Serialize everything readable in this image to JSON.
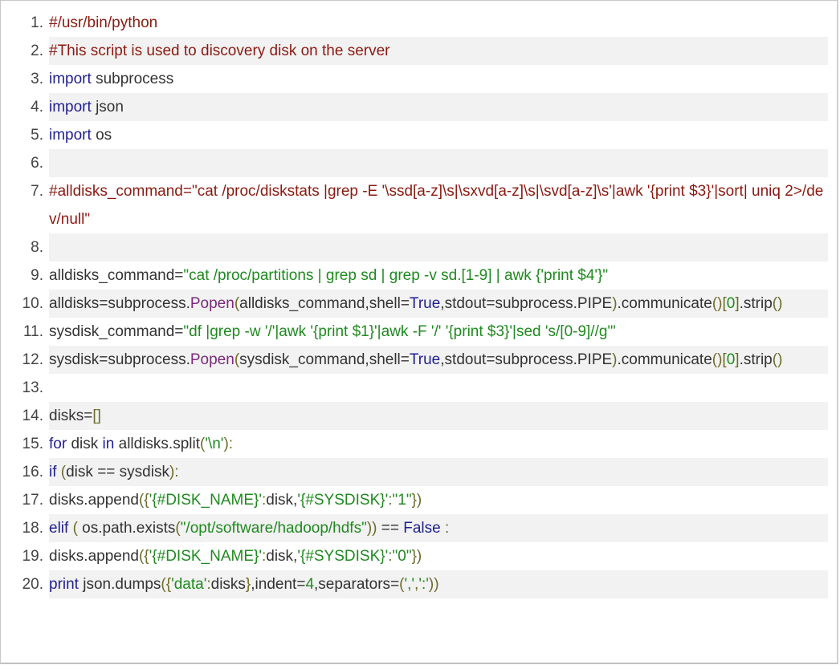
{
  "code": {
    "lines": [
      {
        "n": "1.",
        "parts": [
          {
            "t": "com",
            "v": "#/usr/bin/python"
          }
        ]
      },
      {
        "n": "2.",
        "parts": [
          {
            "t": "com",
            "v": "#This script is used to discovery disk on the server"
          }
        ]
      },
      {
        "n": "3.",
        "parts": [
          {
            "t": "kw",
            "v": "import"
          },
          {
            "t": "id",
            "v": " subprocess"
          }
        ]
      },
      {
        "n": "4.",
        "parts": [
          {
            "t": "kw",
            "v": "import"
          },
          {
            "t": "id",
            "v": " json"
          }
        ]
      },
      {
        "n": "5.",
        "parts": [
          {
            "t": "kw",
            "v": "import"
          },
          {
            "t": "id",
            "v": " os"
          }
        ]
      },
      {
        "n": "6.",
        "parts": []
      },
      {
        "n": "7.",
        "parts": [
          {
            "t": "com",
            "v": "#alldisks_command=\"cat /proc/diskstats |grep -E '\\ssd[a-z]\\s|\\sxvd[a-z]\\s|\\svd[a-z]\\s'|awk '{print $3}'|sort| uniq 2>/dev/null\""
          }
        ]
      },
      {
        "n": "8.",
        "parts": []
      },
      {
        "n": "9.",
        "parts": [
          {
            "t": "id",
            "v": "alldisks_command"
          },
          {
            "t": "op",
            "v": "="
          },
          {
            "t": "str",
            "v": "\"cat /proc/partitions | grep sd | grep -v sd.[1-9] | awk {'print $4'}\""
          }
        ]
      },
      {
        "n": "10.",
        "parts": [
          {
            "t": "id",
            "v": "alldisks"
          },
          {
            "t": "op",
            "v": "="
          },
          {
            "t": "id",
            "v": "subprocess."
          },
          {
            "t": "fn",
            "v": "Popen"
          },
          {
            "t": "pun",
            "v": "("
          },
          {
            "t": "id",
            "v": "alldisks_command,shell"
          },
          {
            "t": "op",
            "v": "="
          },
          {
            "t": "bool",
            "v": "True"
          },
          {
            "t": "id",
            "v": ",stdout"
          },
          {
            "t": "op",
            "v": "="
          },
          {
            "t": "id",
            "v": "subprocess.PIPE"
          },
          {
            "t": "pun",
            "v": ")"
          },
          {
            "t": "id",
            "v": ".communicate"
          },
          {
            "t": "pun",
            "v": "()["
          },
          {
            "t": "num",
            "v": "0"
          },
          {
            "t": "pun",
            "v": "]"
          },
          {
            "t": "id",
            "v": ".strip"
          },
          {
            "t": "pun",
            "v": "()"
          }
        ]
      },
      {
        "n": "11.",
        "parts": [
          {
            "t": "id",
            "v": "sysdisk_command"
          },
          {
            "t": "op",
            "v": "="
          },
          {
            "t": "str",
            "v": "\"df |grep -w '/'|awk '{print $1}'|awk -F '/' '{print $3}'|sed 's/[0-9]//g'\""
          }
        ]
      },
      {
        "n": "12.",
        "parts": [
          {
            "t": "id",
            "v": "sysdisk"
          },
          {
            "t": "op",
            "v": "="
          },
          {
            "t": "id",
            "v": "subprocess."
          },
          {
            "t": "fn",
            "v": "Popen"
          },
          {
            "t": "pun",
            "v": "("
          },
          {
            "t": "id",
            "v": "sysdisk_command,shell"
          },
          {
            "t": "op",
            "v": "="
          },
          {
            "t": "bool",
            "v": "True"
          },
          {
            "t": "id",
            "v": ",stdout"
          },
          {
            "t": "op",
            "v": "="
          },
          {
            "t": "id",
            "v": "subprocess.PIPE"
          },
          {
            "t": "pun",
            "v": ")"
          },
          {
            "t": "id",
            "v": ".communicate"
          },
          {
            "t": "pun",
            "v": "()["
          },
          {
            "t": "num",
            "v": "0"
          },
          {
            "t": "pun",
            "v": "]"
          },
          {
            "t": "id",
            "v": ".strip"
          },
          {
            "t": "pun",
            "v": "()"
          }
        ]
      },
      {
        "n": "13.",
        "parts": []
      },
      {
        "n": "14.",
        "parts": [
          {
            "t": "id",
            "v": "disks"
          },
          {
            "t": "op",
            "v": "="
          },
          {
            "t": "pun",
            "v": "[]"
          }
        ]
      },
      {
        "n": "15.",
        "parts": [
          {
            "t": "kw",
            "v": "for"
          },
          {
            "t": "id",
            "v": " disk "
          },
          {
            "t": "kw",
            "v": "in"
          },
          {
            "t": "id",
            "v": " alldisks.split"
          },
          {
            "t": "pun",
            "v": "("
          },
          {
            "t": "str",
            "v": "'\\n'"
          },
          {
            "t": "pun",
            "v": "):"
          }
        ]
      },
      {
        "n": "16.",
        "parts": [
          {
            "t": "kw",
            "v": "if"
          },
          {
            "t": "id",
            "v": " "
          },
          {
            "t": "pun",
            "v": "("
          },
          {
            "t": "id",
            "v": "disk "
          },
          {
            "t": "op",
            "v": "=="
          },
          {
            "t": "id",
            "v": " sysdisk"
          },
          {
            "t": "pun",
            "v": "):"
          }
        ]
      },
      {
        "n": "17.",
        "parts": [
          {
            "t": "id",
            "v": "disks.append"
          },
          {
            "t": "pun",
            "v": "({"
          },
          {
            "t": "str",
            "v": "'{#DISK_NAME}'"
          },
          {
            "t": "pun",
            "v": ":"
          },
          {
            "t": "id",
            "v": "disk,"
          },
          {
            "t": "str",
            "v": "'{#SYSDISK}'"
          },
          {
            "t": "pun",
            "v": ":"
          },
          {
            "t": "str",
            "v": "\"1\""
          },
          {
            "t": "pun",
            "v": "})"
          }
        ]
      },
      {
        "n": "18.",
        "parts": [
          {
            "t": "kw",
            "v": "elif"
          },
          {
            "t": "id",
            "v": " "
          },
          {
            "t": "pun",
            "v": "("
          },
          {
            "t": "id",
            "v": " os.path.exists"
          },
          {
            "t": "pun",
            "v": "("
          },
          {
            "t": "str",
            "v": "\"/opt/software/hadoop/hdfs\""
          },
          {
            "t": "pun",
            "v": "))"
          },
          {
            "t": "id",
            "v": " "
          },
          {
            "t": "op",
            "v": "=="
          },
          {
            "t": "id",
            "v": " "
          },
          {
            "t": "bool",
            "v": "False"
          },
          {
            "t": "id",
            "v": " "
          },
          {
            "t": "pun",
            "v": ":"
          }
        ]
      },
      {
        "n": "19.",
        "parts": [
          {
            "t": "id",
            "v": "disks.append"
          },
          {
            "t": "pun",
            "v": "({"
          },
          {
            "t": "str",
            "v": "'{#DISK_NAME}'"
          },
          {
            "t": "pun",
            "v": ":"
          },
          {
            "t": "id",
            "v": "disk,"
          },
          {
            "t": "str",
            "v": "'{#SYSDISK}'"
          },
          {
            "t": "pun",
            "v": ":"
          },
          {
            "t": "str",
            "v": "\"0\""
          },
          {
            "t": "pun",
            "v": "})"
          }
        ]
      },
      {
        "n": "20.",
        "parts": [
          {
            "t": "kw",
            "v": "print"
          },
          {
            "t": "id",
            "v": " json.dumps"
          },
          {
            "t": "pun",
            "v": "({"
          },
          {
            "t": "str",
            "v": "'data'"
          },
          {
            "t": "pun",
            "v": ":"
          },
          {
            "t": "id",
            "v": "disks"
          },
          {
            "t": "pun",
            "v": "}"
          },
          {
            "t": "id",
            "v": ",indent"
          },
          {
            "t": "op",
            "v": "="
          },
          {
            "t": "num",
            "v": "4"
          },
          {
            "t": "id",
            "v": ",separators"
          },
          {
            "t": "op",
            "v": "="
          },
          {
            "t": "pun",
            "v": "("
          },
          {
            "t": "str",
            "v": "','"
          },
          {
            "t": "pun",
            "v": ","
          },
          {
            "t": "str",
            "v": "':'"
          },
          {
            "t": "pun",
            "v": "))"
          }
        ]
      }
    ]
  }
}
